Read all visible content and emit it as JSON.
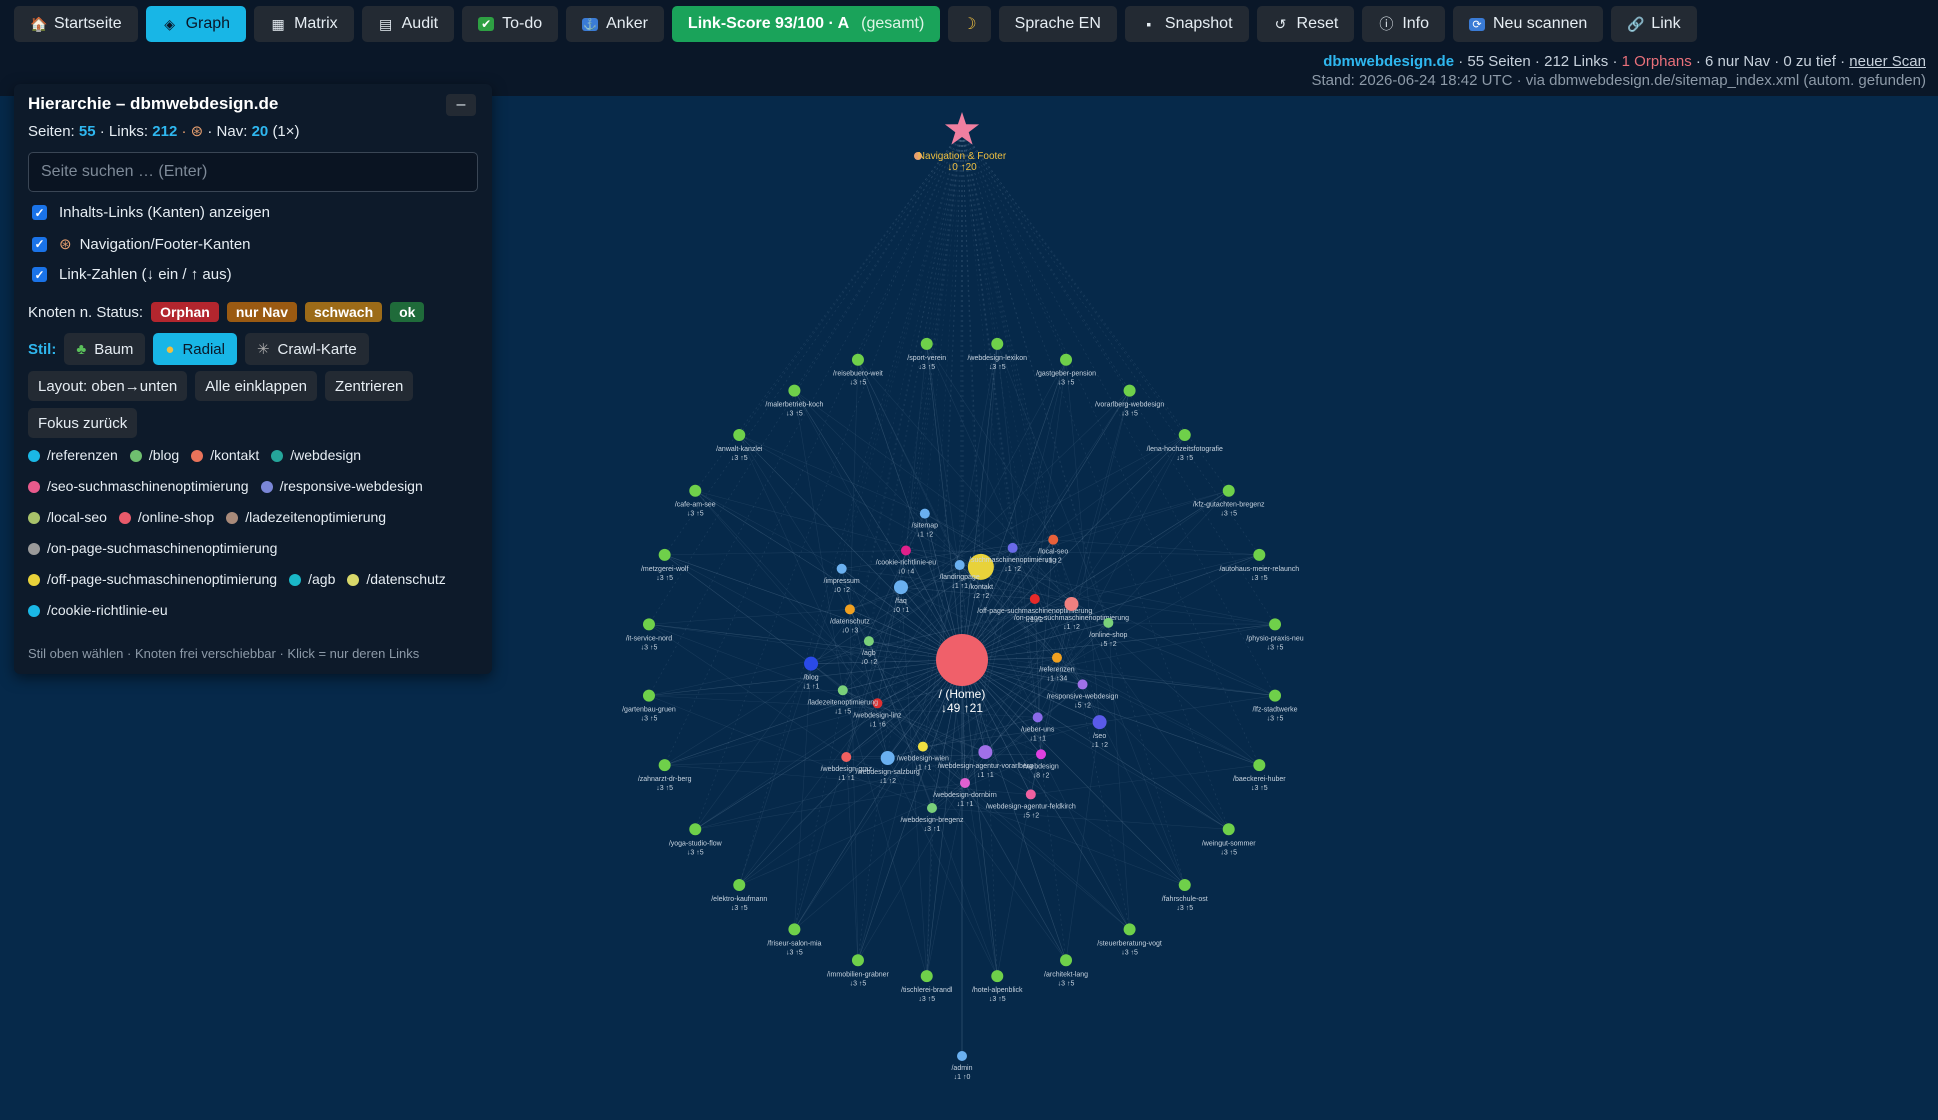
{
  "toolbar": {
    "buttons": [
      {
        "label": "Startseite",
        "icon": "home-icon",
        "glyph": "🏠",
        "active": false
      },
      {
        "label": "Graph",
        "icon": "graph-icon",
        "glyph": "◈",
        "active": true
      },
      {
        "label": "Matrix",
        "icon": "matrix-icon",
        "glyph": "▦",
        "active": false
      },
      {
        "label": "Audit",
        "icon": "audit-icon",
        "glyph": "▤",
        "active": false
      },
      {
        "label": "To-do",
        "icon": "check-icon",
        "glyph": "✔",
        "active": false
      },
      {
        "label": "Anker",
        "icon": "anchor-icon",
        "glyph": "⚓",
        "active": false
      }
    ],
    "score": {
      "label": "Link-Score 93/100 · A",
      "suffix": "(gesamt)"
    },
    "theme_icon": "☽",
    "language": "Sprache EN",
    "snapshot": "Snapshot",
    "reset": "Reset",
    "info": "Info",
    "rescan": "Neu scannen",
    "link": "Link"
  },
  "status": {
    "site": "dbmwebdesign.de",
    "pages": "· 55 Seiten · 212 Links ·",
    "orphans": "1 Orphans",
    "rest": "· 6 nur Nav · 0 zu tief ·",
    "rescan_link": "neuer Scan",
    "stand": "Stand: 2026-06-24 18:42 UTC · via dbmwebdesign.de/sitemap_index.xml (autom. gefunden)"
  },
  "panel": {
    "title": "Hierarchie – dbmwebdesign.de",
    "collapse": "–",
    "stats": {
      "seiten_label": "Seiten:",
      "seiten": "55",
      "links_label": "· Links:",
      "links": "212",
      "nav_label": "· Nav:",
      "nav": "20",
      "nav_suffix": "(1×)"
    },
    "search_placeholder": "Seite suchen … (Enter)",
    "checks": [
      "Inhalts-Links (Kanten) anzeigen",
      "Navigation/Footer-Kanten",
      "Link-Zahlen (↓ ein / ↑ aus)"
    ],
    "status_label": "Knoten n. Status:",
    "status_pills": [
      "Orphan",
      "nur Nav",
      "schwach",
      "ok"
    ],
    "style_label": "Stil:",
    "style_buttons": [
      "Baum",
      "Radial",
      "Crawl-Karte"
    ],
    "actions": [
      "Layout: oben→unten",
      "Alle einklappen",
      "Zentrieren",
      "Fokus zurück"
    ],
    "legend": [
      {
        "label": "/referenzen",
        "color": "#1ab8e6"
      },
      {
        "label": "/blog",
        "color": "#6fbf6f"
      },
      {
        "label": "/kontakt",
        "color": "#e8735a"
      },
      {
        "label": "/webdesign",
        "color": "#25a59a"
      },
      {
        "label": "/seo-suchmaschinenoptimierung",
        "color": "#e85a8c"
      },
      {
        "label": "/responsive-webdesign",
        "color": "#7a86d6"
      },
      {
        "label": "/local-seo",
        "color": "#a8c26a"
      },
      {
        "label": "/online-shop",
        "color": "#e85a6a"
      },
      {
        "label": "/ladezeitenoptimierung",
        "color": "#a88a7a"
      },
      {
        "label": "/on-page-suchmaschinenoptimierung",
        "color": "#9a9a9a"
      },
      {
        "label": "/off-page-suchmaschinenoptimierung",
        "color": "#e8d23a"
      },
      {
        "label": "/agb",
        "color": "#1ab8c8"
      },
      {
        "label": "/datenschutz",
        "color": "#d8d86a"
      },
      {
        "label": "/cookie-richtlinie-eu",
        "color": "#1ab8e6"
      }
    ],
    "footer": "Stil oben wählen · Knoten frei verschiebbar · Klick = nur deren Links"
  },
  "graph": {
    "nav_node": {
      "label": "Navigation & Footer",
      "counts": "↓0 ↑20",
      "color": "#f07fa0"
    },
    "home": {
      "label": "/ (Home)",
      "counts": "↓49 ↑21",
      "color": "#f0606a"
    },
    "outer_nodes": [
      {
        "label": "/webdesign-lexikon",
        "counts": "↓3 ↑5"
      },
      {
        "label": "/gastgeber-pension",
        "counts": "↓3 ↑5"
      },
      {
        "label": "/vorarlberg-webdesign",
        "counts": "↓3 ↑5"
      },
      {
        "label": "/lena-hochzeitsfotografie",
        "counts": "↓3 ↑5"
      },
      {
        "label": "/kfz-gutachten-bregenz",
        "counts": "↓3 ↑5"
      },
      {
        "label": "/autohaus-meier-relaunch",
        "counts": "↓3 ↑5"
      },
      {
        "label": "/physio-praxis-neu",
        "counts": "↓3 ↑5"
      },
      {
        "label": "/lfz-stadtwerke",
        "counts": "↓3 ↑5"
      },
      {
        "label": "/baeckerei-huber",
        "counts": "↓3 ↑5"
      },
      {
        "label": "/weingut-sommer",
        "counts": "↓3 ↑5"
      },
      {
        "label": "/fahrschule-ost",
        "counts": "↓3 ↑5"
      },
      {
        "label": "/steuerberatung-vogt",
        "counts": "↓3 ↑5"
      },
      {
        "label": "/architekt-lang",
        "counts": "↓3 ↑5"
      },
      {
        "label": "/hotel-alpenblick",
        "counts": "↓3 ↑5"
      },
      {
        "label": "/tischlerei-brandl",
        "counts": "↓3 ↑5"
      },
      {
        "label": "/immobilien-grabner",
        "counts": "↓3 ↑5"
      },
      {
        "label": "/friseur-salon-mia",
        "counts": "↓3 ↑5"
      },
      {
        "label": "/elektro-kaufmann",
        "counts": "↓3 ↑5"
      },
      {
        "label": "/yoga-studio-flow",
        "counts": "↓3 ↑5"
      },
      {
        "label": "/zahnarzt-dr-berg",
        "counts": "↓3 ↑5"
      },
      {
        "label": "/gartenbau-gruen",
        "counts": "↓3 ↑5"
      },
      {
        "label": "/it-service-nord",
        "counts": "↓3 ↑5"
      },
      {
        "label": "/metzgerei-wolf",
        "counts": "↓3 ↑5"
      },
      {
        "label": "/cafe-am-see",
        "counts": "↓3 ↑5"
      },
      {
        "label": "/anwalt-kanzlei",
        "counts": "↓3 ↑5"
      },
      {
        "label": "/malerbetrieb-koch",
        "counts": "↓3 ↑5"
      },
      {
        "label": "/reisebuero-weit",
        "counts": "↓3 ↑5"
      },
      {
        "label": "/sport-verein",
        "counts": "↓3 ↑5"
      }
    ],
    "inner_nodes": [
      {
        "label": "/kontakt",
        "counts": "↓2 ↑2",
        "color": "#e8d23a"
      },
      {
        "label": "/suchmaschinenoptimierung",
        "counts": "↓1 ↑2",
        "color": "#6a6ae8"
      },
      {
        "label": "/local-seo",
        "counts": "↓1 ↑2",
        "color": "#e8603a"
      },
      {
        "label": "/off-page-suchmaschinenoptimierung",
        "counts": "↓1 ↑2",
        "color": "#e82a2a"
      },
      {
        "label": "/on-page-suchmaschinenoptimierung",
        "counts": "↓1 ↑2",
        "color": "#f08080"
      },
      {
        "label": "/online-shop",
        "counts": "↓5 ↑2",
        "color": "#7ad07a"
      },
      {
        "label": "/referenzen",
        "counts": "↓1 ↑34",
        "color": "#f0a020"
      },
      {
        "label": "/responsive-webdesign",
        "counts": "↓5 ↑2",
        "color": "#a070e8"
      },
      {
        "label": "/seo",
        "counts": "↓1 ↑2",
        "color": "#5a5ae8"
      },
      {
        "label": "/ueber-uns",
        "counts": "↓1 ↑1",
        "color": "#8a6ae8"
      },
      {
        "label": "/webdesign",
        "counts": "↓8 ↑2",
        "color": "#e040e0"
      },
      {
        "label": "/webdesign-agentur-feldkirch",
        "counts": "↓5 ↑2",
        "color": "#f060a0"
      },
      {
        "label": "/webdesign-agentur-vorarlberg",
        "counts": "↓1 ↑1",
        "color": "#a070e8"
      },
      {
        "label": "/webdesign-dornbirn",
        "counts": "↓1 ↑1",
        "color": "#e060d0"
      },
      {
        "label": "/webdesign-bregenz",
        "counts": "↓3 ↑1",
        "color": "#7ad07a"
      },
      {
        "label": "/webdesign-wien",
        "counts": "↓1 ↑1",
        "color": "#f0e040"
      },
      {
        "label": "/webdesign-salzburg",
        "counts": "↓1 ↑2",
        "color": "#6ab0f0"
      },
      {
        "label": "/webdesign-graz",
        "counts": "↓1 ↑1",
        "color": "#f06060"
      },
      {
        "label": "/webdesign-linz",
        "counts": "↓1 ↑6",
        "color": "#e03030"
      },
      {
        "label": "/ladezeitenoptimierung",
        "counts": "↓1 ↑5",
        "color": "#7ad07a"
      },
      {
        "label": "/blog",
        "counts": "↓1 ↑1",
        "color": "#2a4ae8"
      },
      {
        "label": "/agb",
        "counts": "↓0 ↑2",
        "color": "#7ad07a"
      },
      {
        "label": "/datenschutz",
        "counts": "↓0 ↑3",
        "color": "#f0a020"
      },
      {
        "label": "/impressum",
        "counts": "↓0 ↑2",
        "color": "#6ab0f0"
      },
      {
        "label": "/faq",
        "counts": "↓0 ↑1",
        "color": "#6ab0f0"
      },
      {
        "label": "/cookie-richtlinie-eu",
        "counts": "↓0 ↑4",
        "color": "#e0208a"
      },
      {
        "label": "/sitemap",
        "counts": "↓1 ↑2",
        "color": "#6ab0f0"
      },
      {
        "label": "/landingpage",
        "counts": "↓1 ↑1",
        "color": "#6ab0f0"
      }
    ],
    "bottom_node": {
      "label": "/admin",
      "counts": "↓1 ↑0",
      "color": "#6ab0f0"
    }
  }
}
